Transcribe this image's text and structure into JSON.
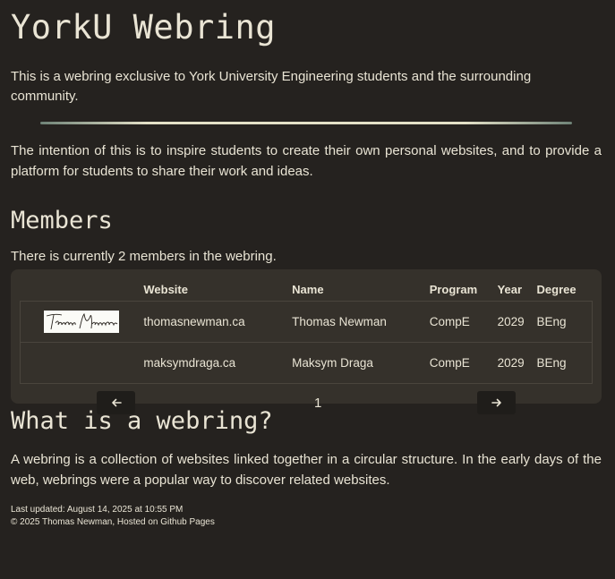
{
  "header": {
    "title": "YorkU Webring",
    "intro": "This is a webring exclusive to York University Engineering students and the surrounding community."
  },
  "intention": "The intention of this is to inspire students to create their own personal websites, and to provide a platform for students to share their work and ideas.",
  "members": {
    "title": "Members",
    "count_text": "There is currently 2 members in the webring.",
    "columns": [
      "",
      "Website",
      "Name",
      "Program",
      "Year",
      "Degree"
    ],
    "rows": [
      {
        "thumbnail": "signature-thumbnail",
        "thumbnail_text": "Thomas Newman",
        "website": "thomasnewman.ca",
        "name": "Thomas Newman",
        "program": "CompE",
        "year": "2029",
        "degree": "BEng"
      },
      {
        "thumbnail": "",
        "website": "maksymdraga.ca",
        "name": "Maksym Draga",
        "program": "CompE",
        "year": "2029",
        "degree": "BEng"
      }
    ],
    "pager": {
      "prev_icon": "arrow-left-icon",
      "next_icon": "arrow-right-icon",
      "page": "1"
    }
  },
  "webring": {
    "title": "What is a webring?",
    "description": "A webring is a collection of websites linked together in a circular structure. In the early days of the web, webrings were a popular way to discover related websites."
  },
  "footer": {
    "updated": "Last updated: August 14, 2025 at 10:55 PM",
    "copyright": "© 2025 Thomas Newman, Hosted on Github Pages"
  },
  "colors": {
    "background": "#25221f",
    "card": "#35312b",
    "text": "#e9e4d4",
    "button": "#1f1d1a"
  }
}
